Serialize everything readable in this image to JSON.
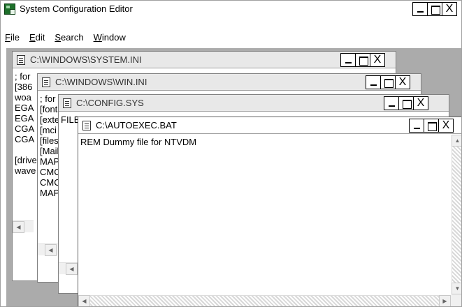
{
  "app": {
    "title": "System Configuration Editor",
    "icon": "sysedit-app-icon"
  },
  "menu": {
    "items": [
      {
        "label": "File",
        "accel": "F"
      },
      {
        "label": "Edit",
        "accel": "E"
      },
      {
        "label": "Search",
        "accel": "S"
      },
      {
        "label": "Window",
        "accel": "W"
      }
    ]
  },
  "window_controls": {
    "minimize": "_",
    "maximize": "□",
    "close": "X"
  },
  "windows": [
    {
      "id": "system-ini",
      "title": "C:\\WINDOWS\\SYSTEM.INI",
      "content_lines": [
        "; for",
        "[386",
        "woa",
        "EGA",
        "EGA",
        "CGA",
        "CGA",
        "",
        "[drive",
        "wave"
      ]
    },
    {
      "id": "win-ini",
      "title": "C:\\WINDOWS\\WIN.INI",
      "content_lines": [
        "; for",
        "[fonts",
        "[exte",
        "[mci",
        "[files",
        "[Mail",
        "MAP",
        "CMC",
        "CMC",
        "MAP"
      ]
    },
    {
      "id": "config-sys",
      "title": "C:\\CONFIG.SYS",
      "content_lines": [
        "FILES"
      ]
    },
    {
      "id": "autoexec-bat",
      "title": "C:\\AUTOEXEC.BAT",
      "content_lines": [
        "REM Dummy file for NTVDM"
      ]
    }
  ],
  "colors": {
    "mdi_background": "#ababab",
    "inactive_title": "#e8e8e8",
    "active_title": "#ffffff",
    "app_icon": "#1d6f2a"
  }
}
